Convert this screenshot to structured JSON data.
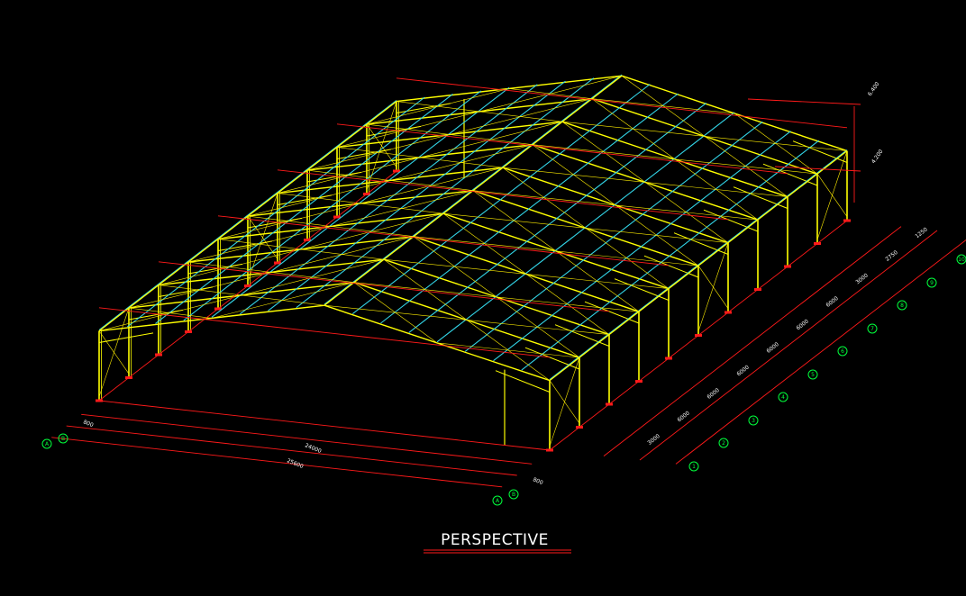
{
  "title": "PERSPECTIVE",
  "colors": {
    "background": "#000000",
    "purlins": "#32d4e6",
    "frames": "#ffff00",
    "bracing": "#ffee00",
    "dimensions": "#ff1a1a",
    "axis_bubbles": "#00ff3c",
    "text": "#ffffff"
  },
  "dimensions": {
    "left_offset_top": "800",
    "span_inner": "24000",
    "span_total": "25600",
    "right_offset": "800",
    "bay_labels": [
      "3000",
      "6000",
      "6000",
      "6000",
      "6000",
      "6000",
      "6000",
      "3000",
      "2750",
      "1250"
    ]
  },
  "axis_labels": {
    "span_left": [
      "A",
      "B"
    ],
    "span_right": [
      "A",
      "B"
    ],
    "bays": [
      "1",
      "2",
      "3",
      "4",
      "5",
      "6",
      "7",
      "8",
      "9",
      "10",
      "11"
    ]
  },
  "elevations": {
    "ridge": "6.400",
    "eave": "4.200"
  }
}
